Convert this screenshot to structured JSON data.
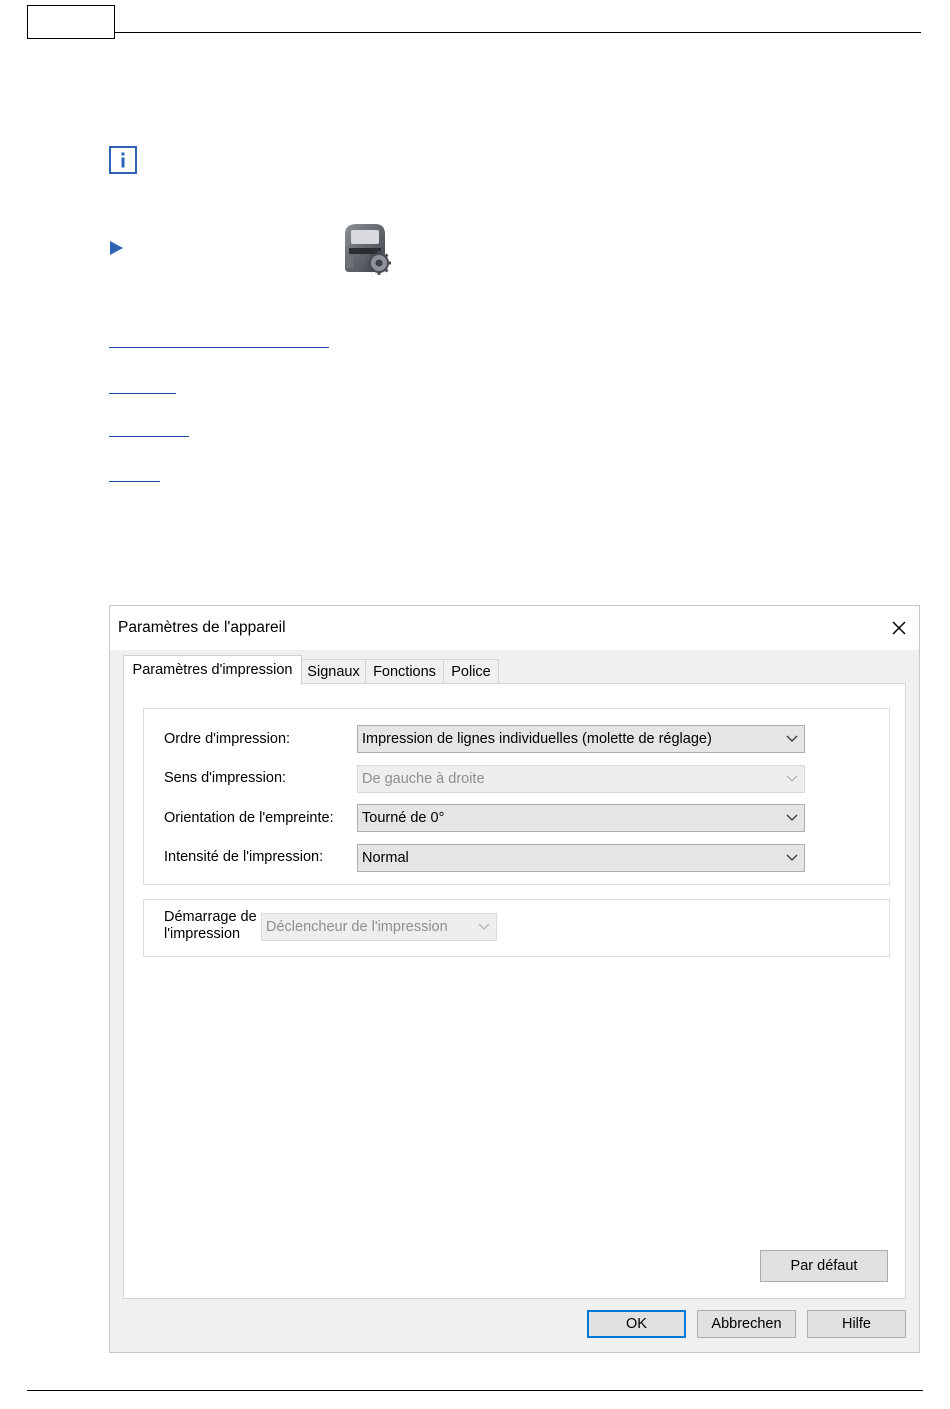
{
  "document": {
    "links": [
      {
        "id": "link-1"
      },
      {
        "id": "link-2"
      },
      {
        "id": "link-3"
      },
      {
        "id": "link-4"
      }
    ]
  },
  "dialog": {
    "title": "Paramètres de l'appareil",
    "tabs": [
      {
        "label": "Paramètres d'impression",
        "active": true
      },
      {
        "label": "Signaux",
        "active": false
      },
      {
        "label": "Fonctions",
        "active": false
      },
      {
        "label": "Police",
        "active": false
      }
    ],
    "print_group": {
      "fields": [
        {
          "label": "Ordre d'impression:",
          "value": "Impression de lignes individuelles (molette de réglage)",
          "enabled": true
        },
        {
          "label": "Sens d'impression:",
          "value": "De gauche à droite",
          "enabled": false
        },
        {
          "label": "Orientation de l'empreinte:",
          "value": "Tourné de 0°",
          "enabled": true
        },
        {
          "label": "Intensité de l'impression:",
          "value": "Normal",
          "enabled": true
        }
      ]
    },
    "start_group": {
      "label_line1": "Démarrage de",
      "label_line2": "l'impression",
      "value": "Déclencheur de l'impression",
      "enabled": false
    },
    "buttons": {
      "default_label": "Par défaut",
      "ok_label": "OK",
      "cancel_label": "Abbrechen",
      "help_label": "Hilfe"
    }
  },
  "colors": {
    "accent": "#2f64b5",
    "link": "#1c4fa0",
    "focus_border": "#0078d7"
  },
  "icons": {
    "info": "info-icon",
    "arrow": "arrow-right-icon",
    "device": "printer-settings-icon",
    "close": "close-icon",
    "dropdown": "chevron-down-icon"
  }
}
